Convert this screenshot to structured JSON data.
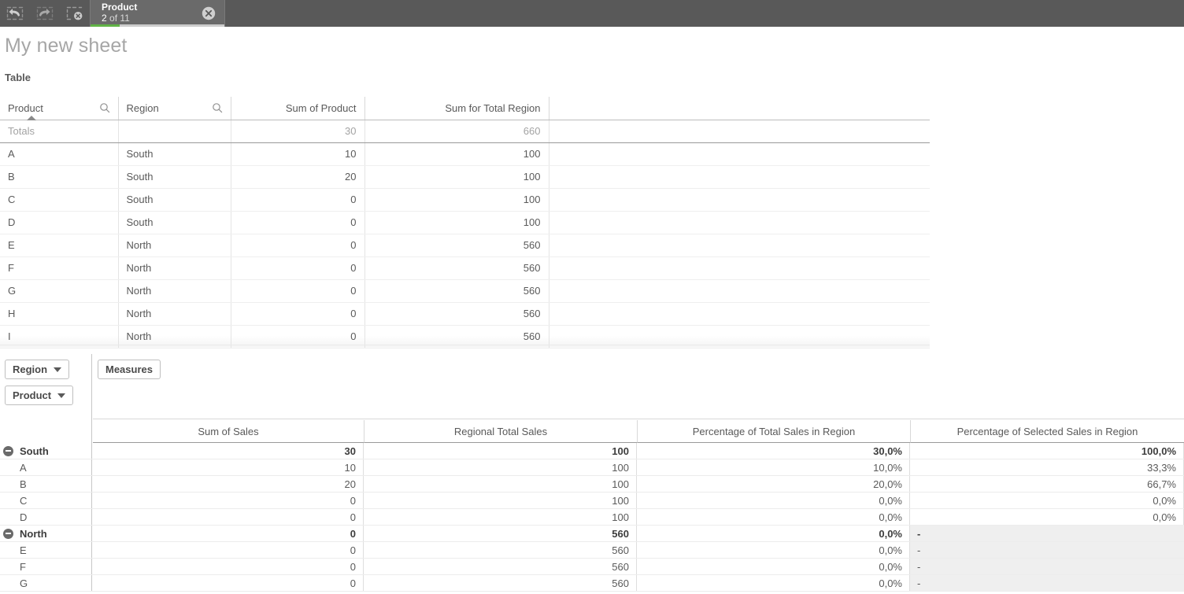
{
  "selection_bar": {
    "tools": [
      {
        "name": "selection-back-icon",
        "label": "Step back in selections"
      },
      {
        "name": "selection-forward-icon",
        "label": "Step forward in selections"
      },
      {
        "name": "clear-all-selections-icon",
        "label": "Clear all selections"
      }
    ],
    "chip": {
      "field": "Product",
      "count_prefix": "2",
      "count_suffix": " of 11",
      "clear_icon": "clear-selection-icon",
      "progress_percent": 22,
      "progress_color": "#61b346"
    }
  },
  "sheet": {
    "title": "My new sheet"
  },
  "straight_table": {
    "title": "Table",
    "columns": [
      {
        "label": "Product",
        "type": "dimension",
        "search_icon": "search-icon",
        "sorted": true
      },
      {
        "label": "Region",
        "type": "dimension",
        "search_icon": "search-icon",
        "sorted": false
      },
      {
        "label": "Sum of Product",
        "type": "measure"
      },
      {
        "label": "Sum for Total Region",
        "type": "measure"
      },
      {
        "label": "",
        "type": "blank"
      }
    ],
    "totals_label": "Totals",
    "totals": [
      "Totals",
      "",
      "30",
      "660",
      ""
    ],
    "rows": [
      [
        "A",
        "South",
        "10",
        "100",
        ""
      ],
      [
        "B",
        "South",
        "20",
        "100",
        ""
      ],
      [
        "C",
        "South",
        "0",
        "100",
        ""
      ],
      [
        "D",
        "South",
        "0",
        "100",
        ""
      ],
      [
        "E",
        "North",
        "0",
        "560",
        ""
      ],
      [
        "F",
        "North",
        "0",
        "560",
        ""
      ],
      [
        "G",
        "North",
        "0",
        "560",
        ""
      ],
      [
        "H",
        "North",
        "0",
        "560",
        ""
      ],
      [
        "I",
        "North",
        "0",
        "560",
        ""
      ]
    ]
  },
  "pivot_table": {
    "row_dimensions": [
      {
        "label": "Region",
        "caret": "chevron-down-icon"
      },
      {
        "label": "Product",
        "caret": "chevron-down-icon"
      }
    ],
    "measures_pill": "Measures",
    "columns": [
      "Sum of Sales",
      "Regional Total Sales",
      "Percentage of Total Sales in Region",
      "Percentage of Selected Sales in Region"
    ],
    "rows": [
      {
        "label": "South",
        "level": 0,
        "expanded": true,
        "collapse_icon": "collapse-icon",
        "values": [
          "30",
          "100",
          "30,0%",
          "100,0%"
        ],
        "null_last": false
      },
      {
        "label": "A",
        "level": 1,
        "expanded": false,
        "values": [
          "10",
          "100",
          "10,0%",
          "33,3%"
        ],
        "null_last": false
      },
      {
        "label": "B",
        "level": 1,
        "expanded": false,
        "values": [
          "20",
          "100",
          "20,0%",
          "66,7%"
        ],
        "null_last": false
      },
      {
        "label": "C",
        "level": 1,
        "expanded": false,
        "values": [
          "0",
          "100",
          "0,0%",
          "0,0%"
        ],
        "null_last": false
      },
      {
        "label": "D",
        "level": 1,
        "expanded": false,
        "values": [
          "0",
          "100",
          "0,0%",
          "0,0%"
        ],
        "null_last": false
      },
      {
        "label": "North",
        "level": 0,
        "expanded": true,
        "collapse_icon": "collapse-icon",
        "values": [
          "0",
          "560",
          "0,0%",
          "-"
        ],
        "null_last": true
      },
      {
        "label": "E",
        "level": 1,
        "expanded": false,
        "values": [
          "0",
          "560",
          "0,0%",
          "-"
        ],
        "null_last": true
      },
      {
        "label": "F",
        "level": 1,
        "expanded": false,
        "values": [
          "0",
          "560",
          "0,0%",
          "-"
        ],
        "null_last": true
      },
      {
        "label": "G",
        "level": 1,
        "expanded": false,
        "values": [
          "0",
          "560",
          "0,0%",
          "-"
        ],
        "null_last": true
      }
    ]
  }
}
